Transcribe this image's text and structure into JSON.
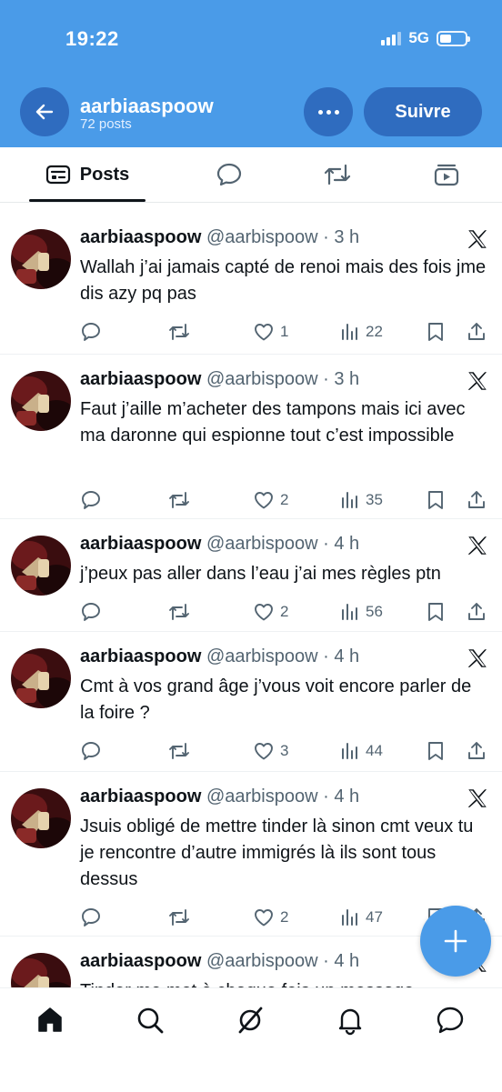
{
  "status_bar": {
    "time": "19:22",
    "network": "5G",
    "battery_level": 0.45
  },
  "header": {
    "name": "aarbiaaspoow",
    "posts_count": "72 posts",
    "follow_label": "Suivre"
  },
  "tabs": [
    {
      "label": "Posts",
      "icon": "posts-icon"
    },
    {
      "icon": "replies-icon"
    },
    {
      "icon": "reposts-icon"
    },
    {
      "icon": "media-icon"
    }
  ],
  "posts": [
    {
      "name": "aarbiaaspoow",
      "handle": "@aarbispoow",
      "time": "· 3 h",
      "text": "Wallah j’ai jamais capté de renoi mais des fois jme dis azy pq pas",
      "likes": "1",
      "views": "22"
    },
    {
      "name": "aarbiaaspoow",
      "handle": "@aarbispoow",
      "time": "· 3 h",
      "text": "Faut j’aille m’acheter des tampons mais ici avec ma daronne qui espionne tout c’est impossible",
      "likes": "2",
      "views": "35"
    },
    {
      "name": "aarbiaaspoow",
      "handle": "@aarbispoow",
      "time": "· 4 h",
      "text": "j’peux pas aller dans l’eau j’ai mes règles ptn",
      "likes": "2",
      "views": "56"
    },
    {
      "name": "aarbiaaspoow",
      "handle": "@aarbispoow",
      "time": "· 4 h",
      "text": "Cmt à vos grand âge j’vous voit encore parler de la foire ?",
      "likes": "3",
      "views": "44"
    },
    {
      "name": "aarbiaaspoow",
      "handle": "@aarbispoow",
      "time": "· 4 h",
      "text": "Jsuis obligé de mettre tinder là sinon cmt veux tu je rencontre d’autre immigrés là ils sont tous dessus",
      "likes": "2",
      "views": "47"
    },
    {
      "name": "aarbiaaspoow",
      "handle": "@aarbispoow",
      "time": "· 4 h",
      "text": "Tinder me met à chaque fois un message",
      "likes": "",
      "views": ""
    }
  ],
  "bottom_nav": [
    "home-icon",
    "search-icon",
    "grok-icon",
    "notifications-icon",
    "messages-icon"
  ],
  "colors": {
    "accent": "#4a9be8",
    "button": "#2f6cbf"
  }
}
